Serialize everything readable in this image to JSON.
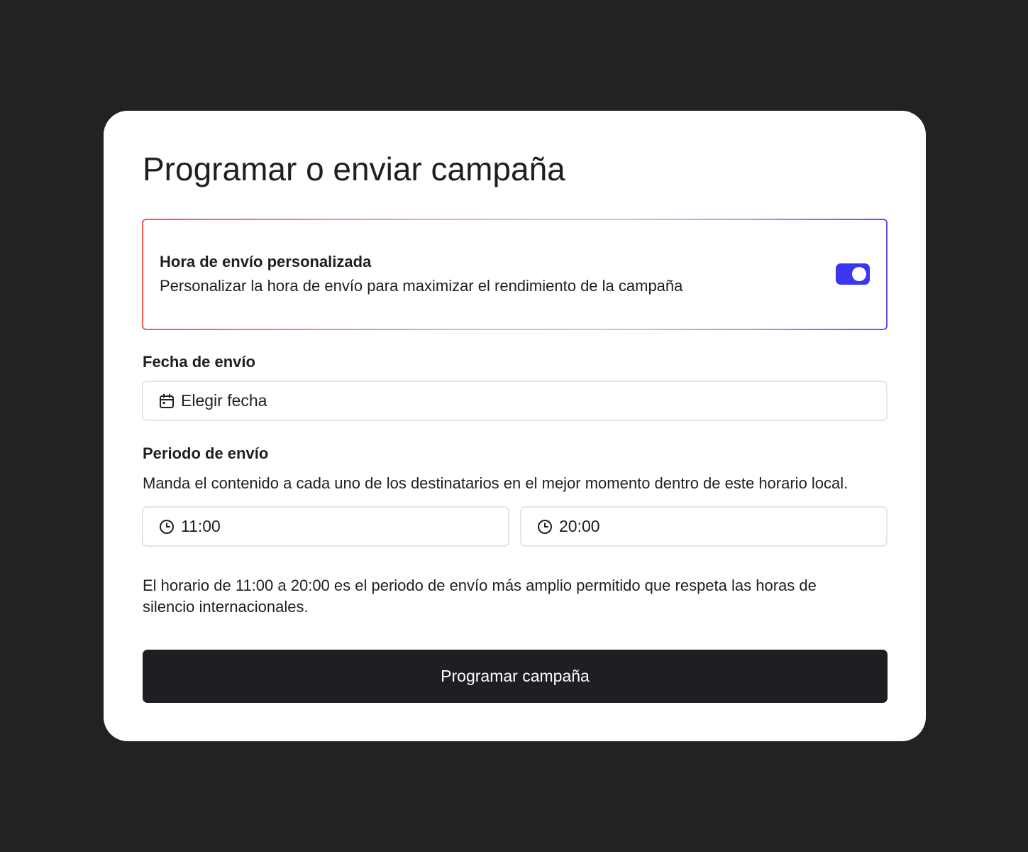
{
  "dialog": {
    "title": "Programar o enviar campaña"
  },
  "custom_send_time": {
    "title": "Hora de envío personalizada",
    "description": "Personalizar la hora de envío para maximizar el rendimiento de la campaña",
    "enabled": true,
    "accent_color": "#3b36ef"
  },
  "send_date": {
    "label": "Fecha de envío",
    "placeholder": "Elegir fecha",
    "icon": "calendar-icon"
  },
  "send_period": {
    "label": "Periodo de envío",
    "description": "Manda el contenido a cada uno de los destinatarios en el mejor momento dentro de este horario local.",
    "start_time": "11:00",
    "end_time": "20:00",
    "icon": "clock-icon",
    "note": "El horario de 11:00 a 20:00 es el periodo de envío más amplio permitido que respeta las horas de silencio internacionales."
  },
  "actions": {
    "submit_label": "Programar campaña"
  }
}
